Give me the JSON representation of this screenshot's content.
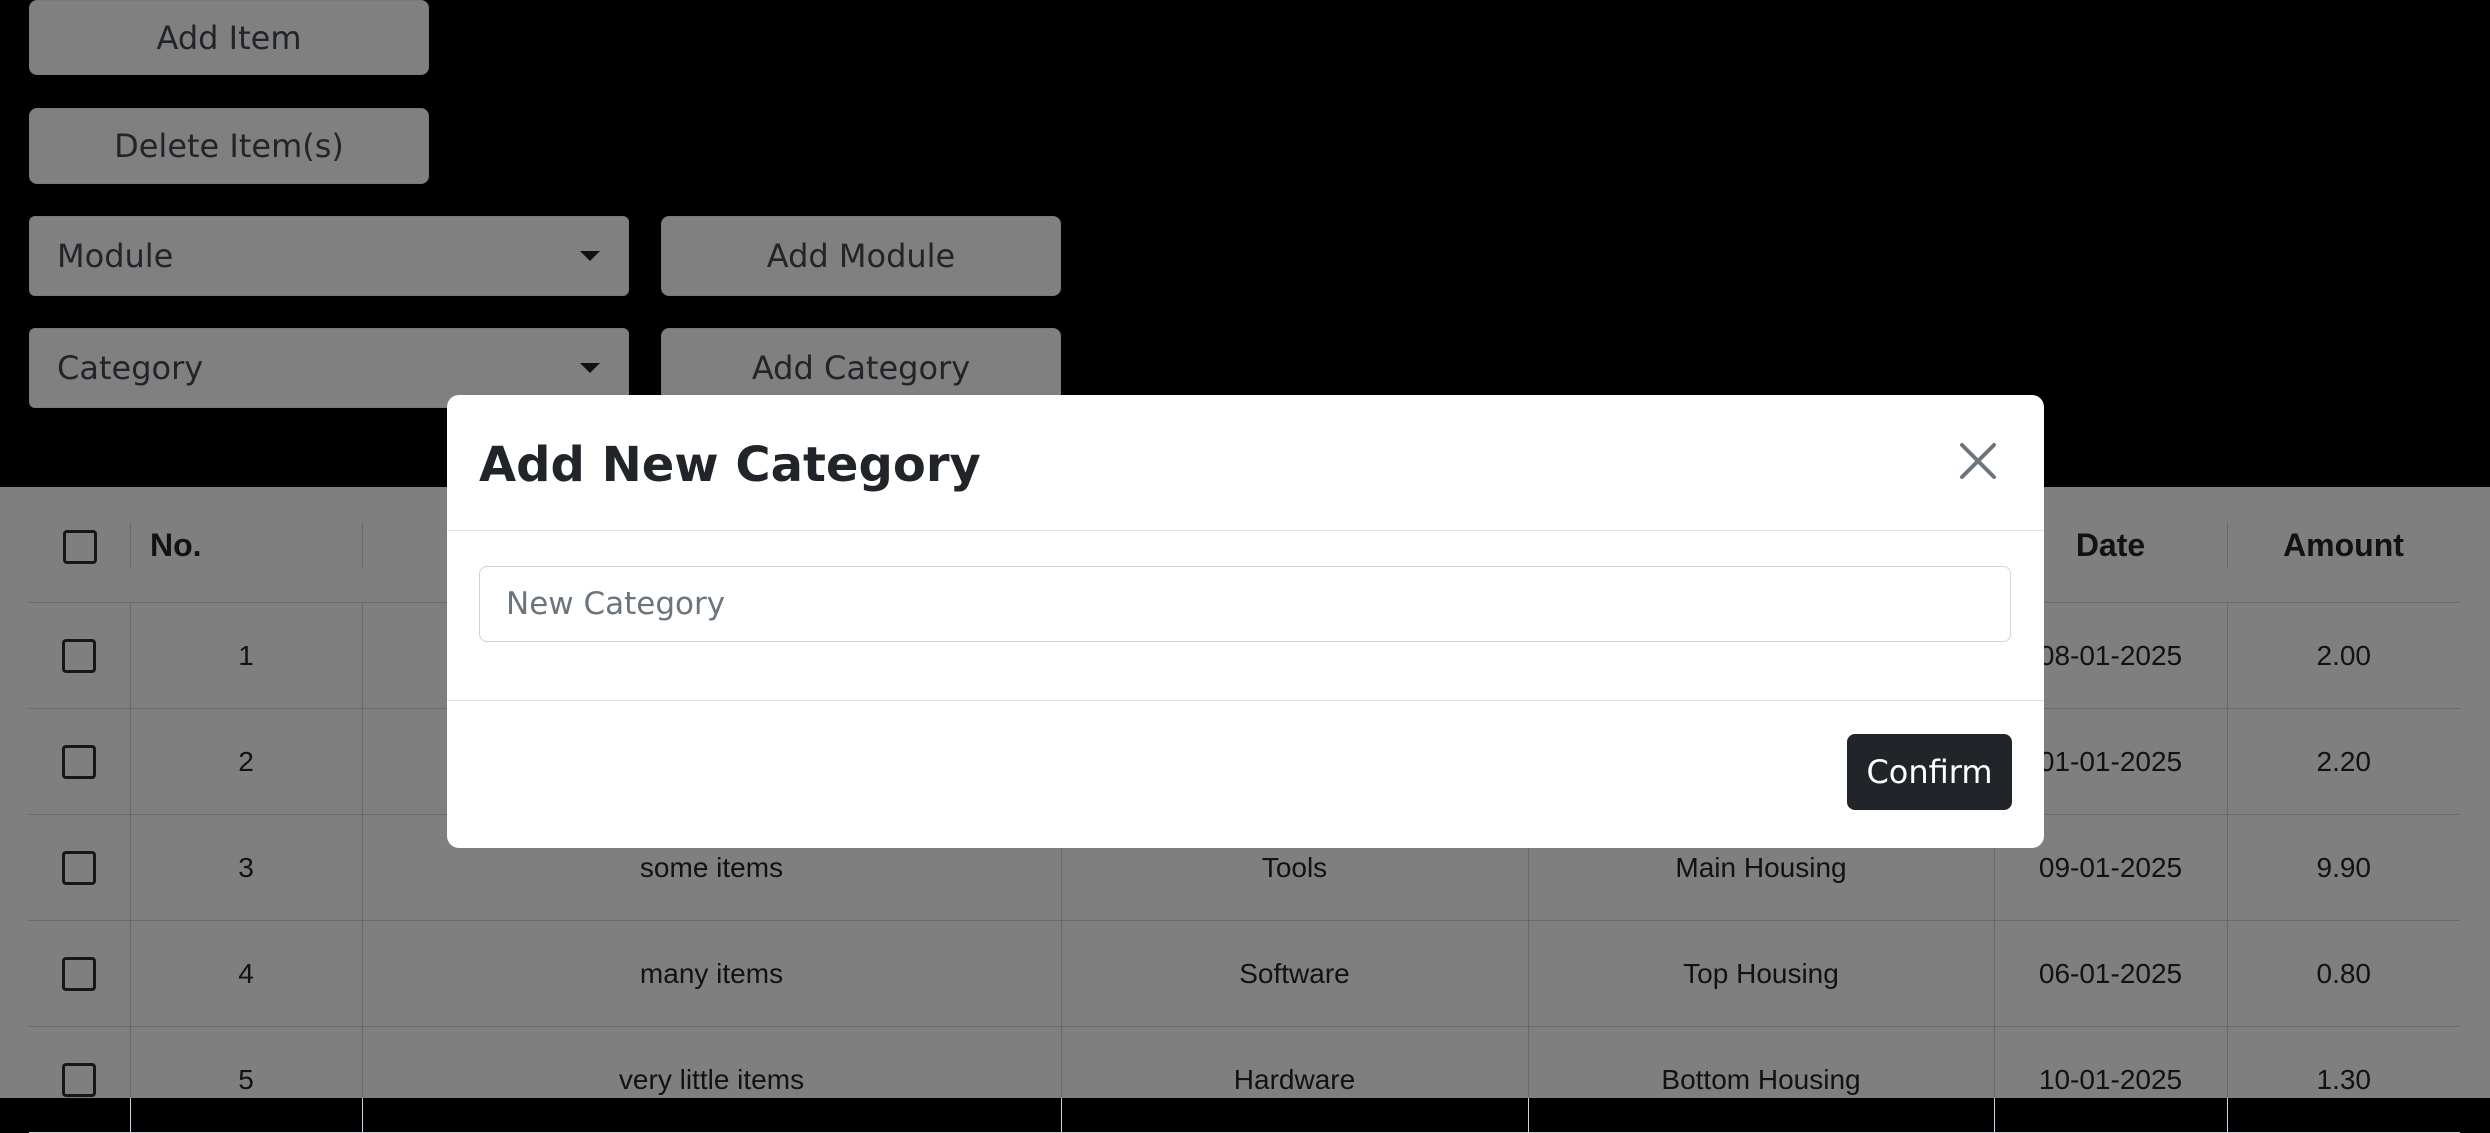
{
  "toolbar": {
    "add_item_label": "Add Item",
    "delete_items_label": "Delete Item(s)",
    "module_select_value": "Module",
    "add_module_label": "Add Module",
    "category_select_value": "Category",
    "add_category_label": "Add Category"
  },
  "table": {
    "headers": {
      "no": "No.",
      "date": "Date",
      "amount": "Amount"
    },
    "rows": [
      {
        "no": "1",
        "name": "",
        "category": "",
        "module": "",
        "date": "08-01-2025",
        "amount": "2.00"
      },
      {
        "no": "2",
        "name": "",
        "category": "",
        "module": "",
        "date": "01-01-2025",
        "amount": "2.20"
      },
      {
        "no": "3",
        "name": "some items",
        "category": "Tools",
        "module": "Main Housing",
        "date": "09-01-2025",
        "amount": "9.90"
      },
      {
        "no": "4",
        "name": "many items",
        "category": "Software",
        "module": "Top Housing",
        "date": "06-01-2025",
        "amount": "0.80"
      },
      {
        "no": "5",
        "name": "very little items",
        "category": "Hardware",
        "module": "Bottom Housing",
        "date": "10-01-2025",
        "amount": "1.30"
      }
    ]
  },
  "modal": {
    "title": "Add New Category",
    "input_placeholder": "New Category",
    "input_value": "",
    "confirm_label": "Confirm",
    "close_icon": "close-icon"
  },
  "colors": {
    "backdrop": "#000000",
    "confirm_bg": "#212529",
    "button_bg_dimmed": "#808080"
  }
}
